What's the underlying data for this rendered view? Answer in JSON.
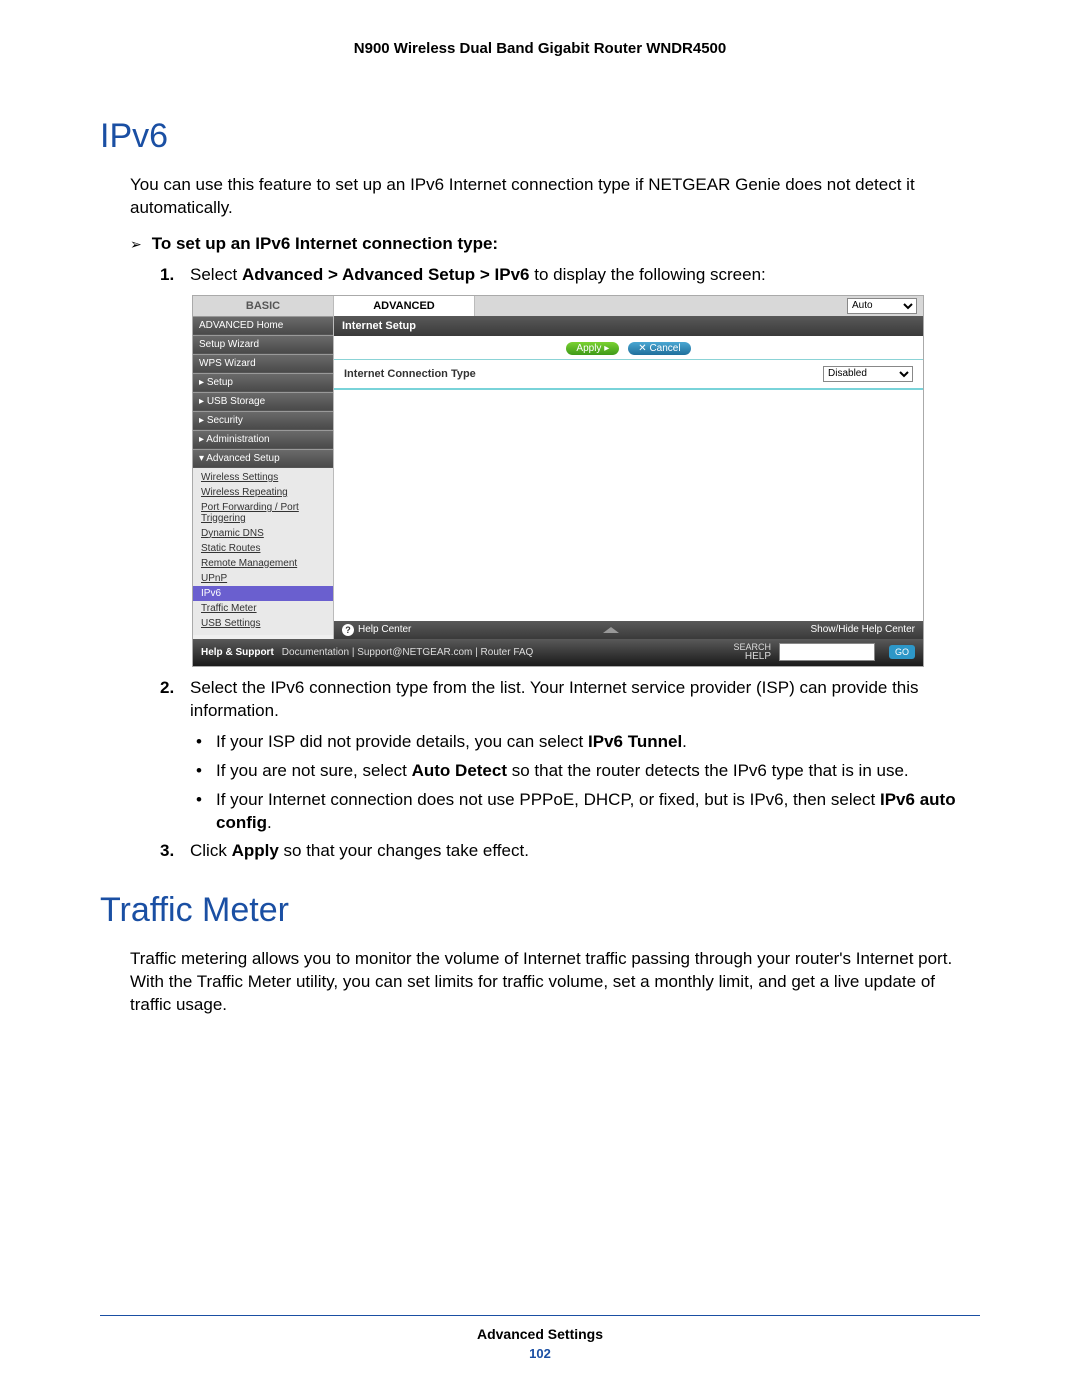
{
  "doc_header": "N900 Wireless Dual Band Gigabit Router WNDR4500",
  "section1_title": "IPv6",
  "section1_intro": "You can use this feature to set up an IPv6 Internet connection type if NETGEAR Genie does not detect it automatically.",
  "task_heading": "To set up an IPv6 Internet connection type:",
  "step1_prefix": "Select ",
  "step1_boldpath": "Advanced > Advanced Setup > IPv6",
  "step1_suffix": " to display the following screen:",
  "step2_text": "Select the IPv6 connection type from the list. Your Internet service provider (ISP) can provide this information.",
  "sb1_prefix": "If your ISP did not provide details, you can select ",
  "sb1_bold": "IPv6 Tunnel",
  "sb1_suffix": ".",
  "sb2_prefix": "If you are not sure, select ",
  "sb2_bold": "Auto Detect",
  "sb2_suffix": " so that the router detects the IPv6 type that is in use.",
  "sb3_prefix": "If your Internet connection does not use PPPoE, DHCP, or fixed, but is IPv6, then select ",
  "sb3_bold": "IPv6 auto config",
  "sb3_suffix": ".",
  "step3_prefix": "Click ",
  "step3_bold": "Apply",
  "step3_suffix": " so that your changes take effect.",
  "section2_title": "Traffic Meter",
  "section2_body": "Traffic metering allows you to monitor the volume of Internet traffic passing through your router's Internet port. With the Traffic Meter utility, you can set limits for traffic volume, set a monthly limit, and get a live update of traffic usage.",
  "footer_title": "Advanced Settings",
  "footer_page": "102",
  "ui": {
    "tabs": {
      "basic": "BASIC",
      "advanced": "ADVANCED"
    },
    "top_select": "Auto",
    "sidebar": {
      "s1": "ADVANCED Home",
      "s2": "Setup Wizard",
      "s3": "WPS Wizard",
      "s4": "Setup",
      "s5": "USB Storage",
      "s6": "Security",
      "s7": "Administration",
      "s8": "Advanced Setup",
      "sub": [
        "Wireless Settings",
        "Wireless Repeating",
        "Port Forwarding / Port Triggering",
        "Dynamic DNS",
        "Static Routes",
        "Remote Management",
        "UPnP",
        "IPv6",
        "Traffic Meter",
        "USB Settings"
      ]
    },
    "panel_title": "Internet Setup",
    "apply": "Apply ▸",
    "cancel": "✕ Cancel",
    "conn_label": "Internet Connection Type",
    "conn_value": "Disabled",
    "help_center": "Help Center",
    "help_toggle": "Show/Hide Help Center",
    "hs": "Help & Support",
    "hs_links": "Documentation | Support@NETGEAR.com | Router FAQ",
    "search1": "SEARCH",
    "search2": "HELP",
    "go": "GO"
  }
}
